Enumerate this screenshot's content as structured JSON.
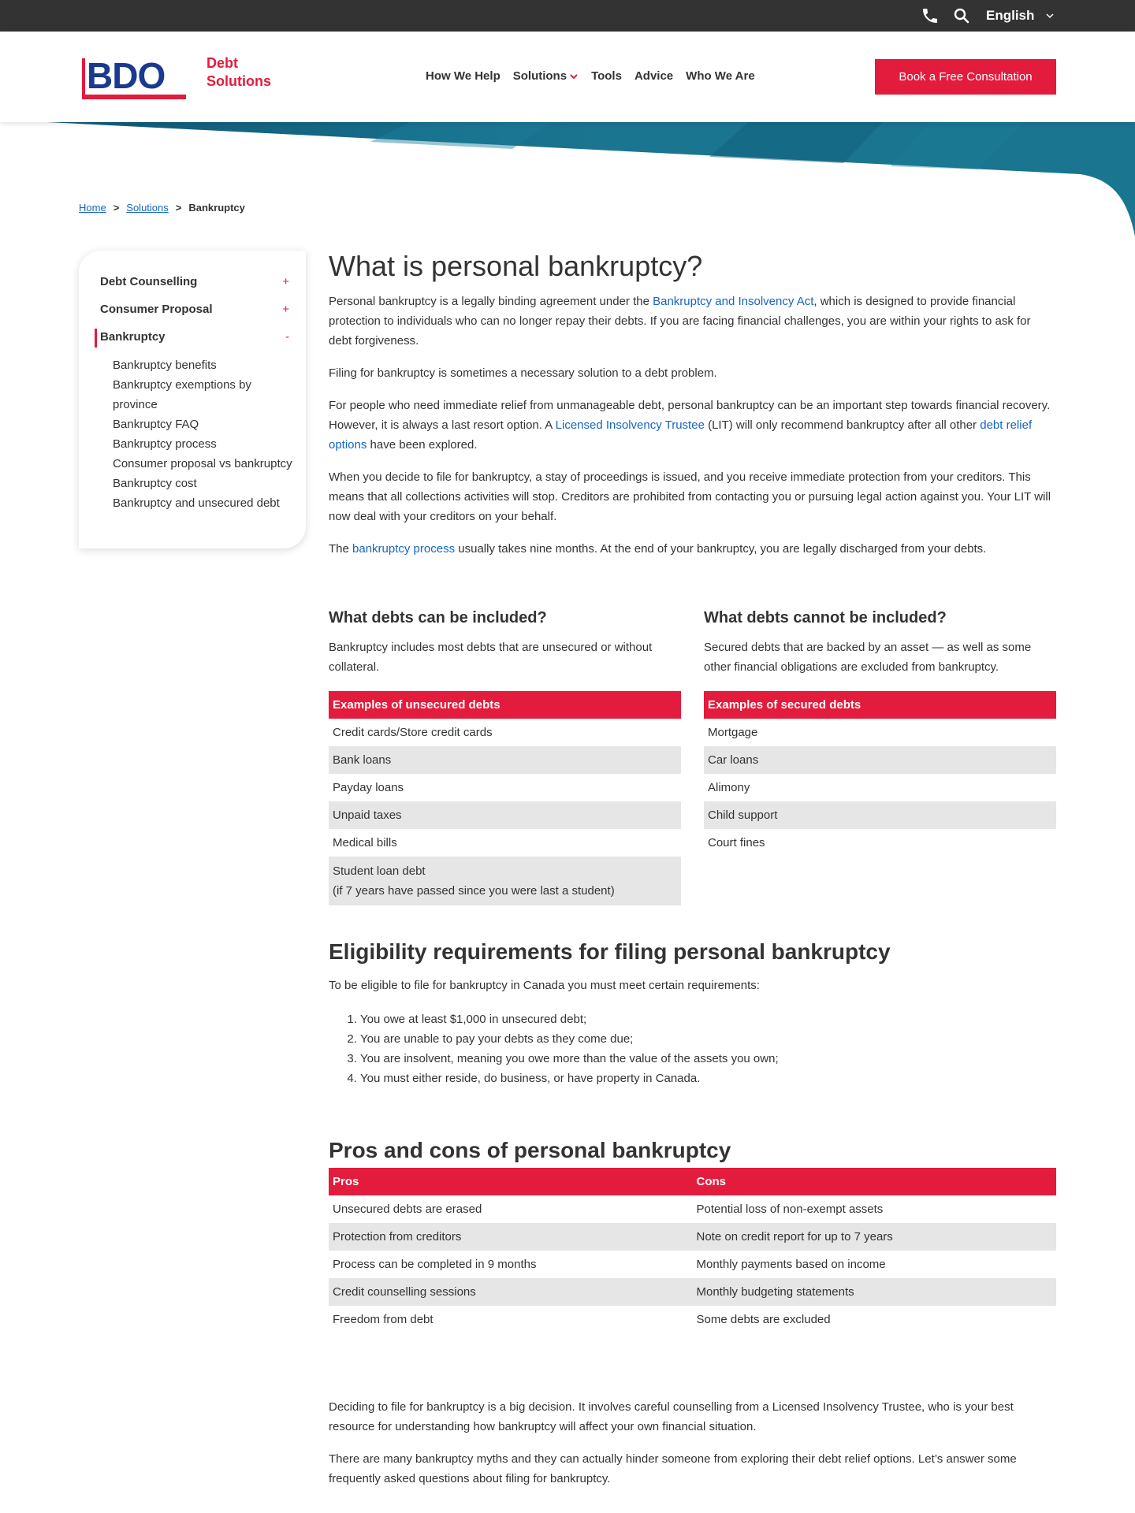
{
  "utility_bar": {
    "icons": [
      "phone-icon",
      "search-icon"
    ],
    "language": "English"
  },
  "header": {
    "logo_text": "BDO",
    "brand_line1": "Debt",
    "brand_line2": "Solutions",
    "nav": [
      {
        "label": "How We Help"
      },
      {
        "label": "Solutions",
        "has_dropdown": true
      },
      {
        "label": "Tools"
      },
      {
        "label": "Advice"
      },
      {
        "label": "Who We Are"
      }
    ],
    "cta_label": "Book a Free Consultation"
  },
  "colors": {
    "brand_red": "#e31b3c",
    "brand_blue": "#1a3a8f",
    "link_blue": "#1565c0",
    "banner_teal": "#1a7590",
    "dark_bar": "#333333",
    "row_stripe": "#e6e6e6"
  },
  "breadcrumb": {
    "items": [
      {
        "label": "Home",
        "link": true
      },
      {
        "label": "Solutions",
        "link": true
      },
      {
        "label": "Bankruptcy",
        "link": false
      }
    ],
    "separator": ">"
  },
  "sidebar": {
    "sections": [
      {
        "label": "Debt Counselling",
        "toggle": "+"
      },
      {
        "label": "Consumer Proposal",
        "toggle": "+"
      },
      {
        "label": "Bankruptcy",
        "toggle": "-",
        "active": true
      }
    ],
    "sub_items": [
      "Bankruptcy benefits",
      "Bankruptcy exemptions by province",
      "Bankruptcy FAQ",
      "Bankruptcy process",
      "Consumer proposal vs bankruptcy",
      "Bankruptcy cost",
      "Bankruptcy and unsecured debt"
    ]
  },
  "main": {
    "title": "What is personal bankruptcy?",
    "p1_a": "Personal bankruptcy is a legally binding agreement under the ",
    "p1_link": "Bankruptcy and Insolvency Act",
    "p1_b": ", which is designed to provide financial protection to individuals who can no longer repay their debts. If you are facing financial challenges, you are within your rights to ask for debt forgiveness.",
    "p2": "Filing for bankruptcy is sometimes a necessary solution to a debt problem.",
    "p3_a": "For people who need immediate relief from unmanageable debt, personal bankruptcy can be an important step towards financial recovery. However, it is always a last resort option. A ",
    "p3_link1": "Licensed Insolvency Trustee",
    "p3_b": " (LIT) will only recommend bankruptcy after all other ",
    "p3_link2": "debt relief options",
    "p3_c": " have been explored.",
    "p4": "When you decide to file for bankruptcy, a stay of proceedings is issued, and you receive immediate protection from your creditors. This means that all collections activities will stop. Creditors are prohibited from contacting you or pursuing legal action against you. Your LIT will now deal with your creditors on your behalf.",
    "p5_a": "The ",
    "p5_link": "bankruptcy process",
    "p5_b": " usually takes nine months. At the end of your bankruptcy, you are legally discharged from your debts."
  },
  "included": {
    "heading": "What debts can be included?",
    "desc": "Bankruptcy includes most debts that are unsecured or without collateral.",
    "table_header": "Examples of unsecured debts",
    "rows": [
      "Credit cards/Store credit cards",
      "Bank loans",
      "Payday loans",
      "Unpaid taxes",
      "Medical bills"
    ],
    "last_row_line1": "Student loan debt",
    "last_row_line2": "(if 7 years have passed since you were last a student)"
  },
  "excluded": {
    "heading": "What debts cannot be included?",
    "desc": "Secured debts that are backed by an asset — as well as some other financial obligations are excluded from bankruptcy.",
    "table_header": "Examples of secured debts",
    "rows": [
      "Mortgage",
      "Car loans",
      "Alimony",
      "Child support",
      "Court fines"
    ]
  },
  "eligibility": {
    "heading": "Eligibility requirements for filing personal bankruptcy",
    "intro": "To be eligible to file for bankruptcy in Canada you must meet certain requirements:",
    "items": [
      "You owe at least $1,000 in unsecured debt;",
      "You are unable to pay your debts as they come due;",
      "You are insolvent, meaning you owe more than the value of the assets you own;",
      "You must either reside, do business, or have property in Canada."
    ]
  },
  "pros_cons": {
    "heading": "Pros and cons of personal bankruptcy",
    "header_pros": "Pros",
    "header_cons": "Cons",
    "rows": [
      {
        "pro": "Unsecured debts are erased",
        "con": "Potential loss of non-exempt assets"
      },
      {
        "pro": "Protection from creditors",
        "con": "Note on credit report for up to 7 years"
      },
      {
        "pro": "Process can be completed in 9 months",
        "con": "Monthly payments based on income"
      },
      {
        "pro": "Credit counselling sessions",
        "con": "Monthly budgeting statements"
      },
      {
        "pro": "Freedom from debt",
        "con": "Some debts are excluded"
      }
    ]
  },
  "closing": {
    "p1": "Deciding to file for bankruptcy is a big decision. It involves careful counselling from a Licensed Insolvency Trustee, who is your best resource for understanding how bankruptcy will affect your own financial situation.",
    "p2": "There are many bankruptcy myths and they can actually hinder someone from exploring their debt relief options. Let’s answer some frequently asked questions about filing for bankruptcy."
  }
}
